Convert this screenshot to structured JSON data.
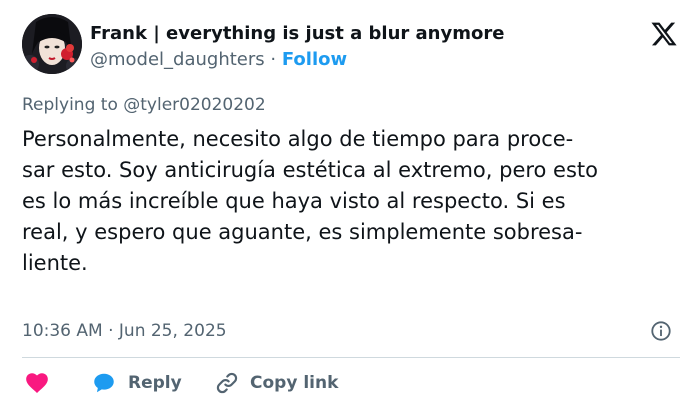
{
  "author": {
    "display_name": "Frank | everything is just a blur anymore",
    "handle": "@model_daughters",
    "separator": "·",
    "follow_label": "Follow"
  },
  "reply_context": {
    "prefix": "Replying to",
    "user": "@tyler02020202"
  },
  "post": {
    "lines": [
      "Personalmente, necesito algo de tiempo para proce-",
      "sar esto. Soy anticirugía estética al extremo, pero esto",
      "es lo más increíble que haya visto al respecto. Si es",
      "real, y espero que aguante, es simplemente sobresa-",
      "liente."
    ]
  },
  "meta": {
    "timestamp": "10:36 AM · Jun 25, 2025"
  },
  "actions": {
    "reply_label": "Reply",
    "copy_link_label": "Copy link"
  },
  "colors": {
    "accent": "#1d9bf0",
    "like": "#f91880",
    "muted": "#536471",
    "text": "#0f1419"
  }
}
